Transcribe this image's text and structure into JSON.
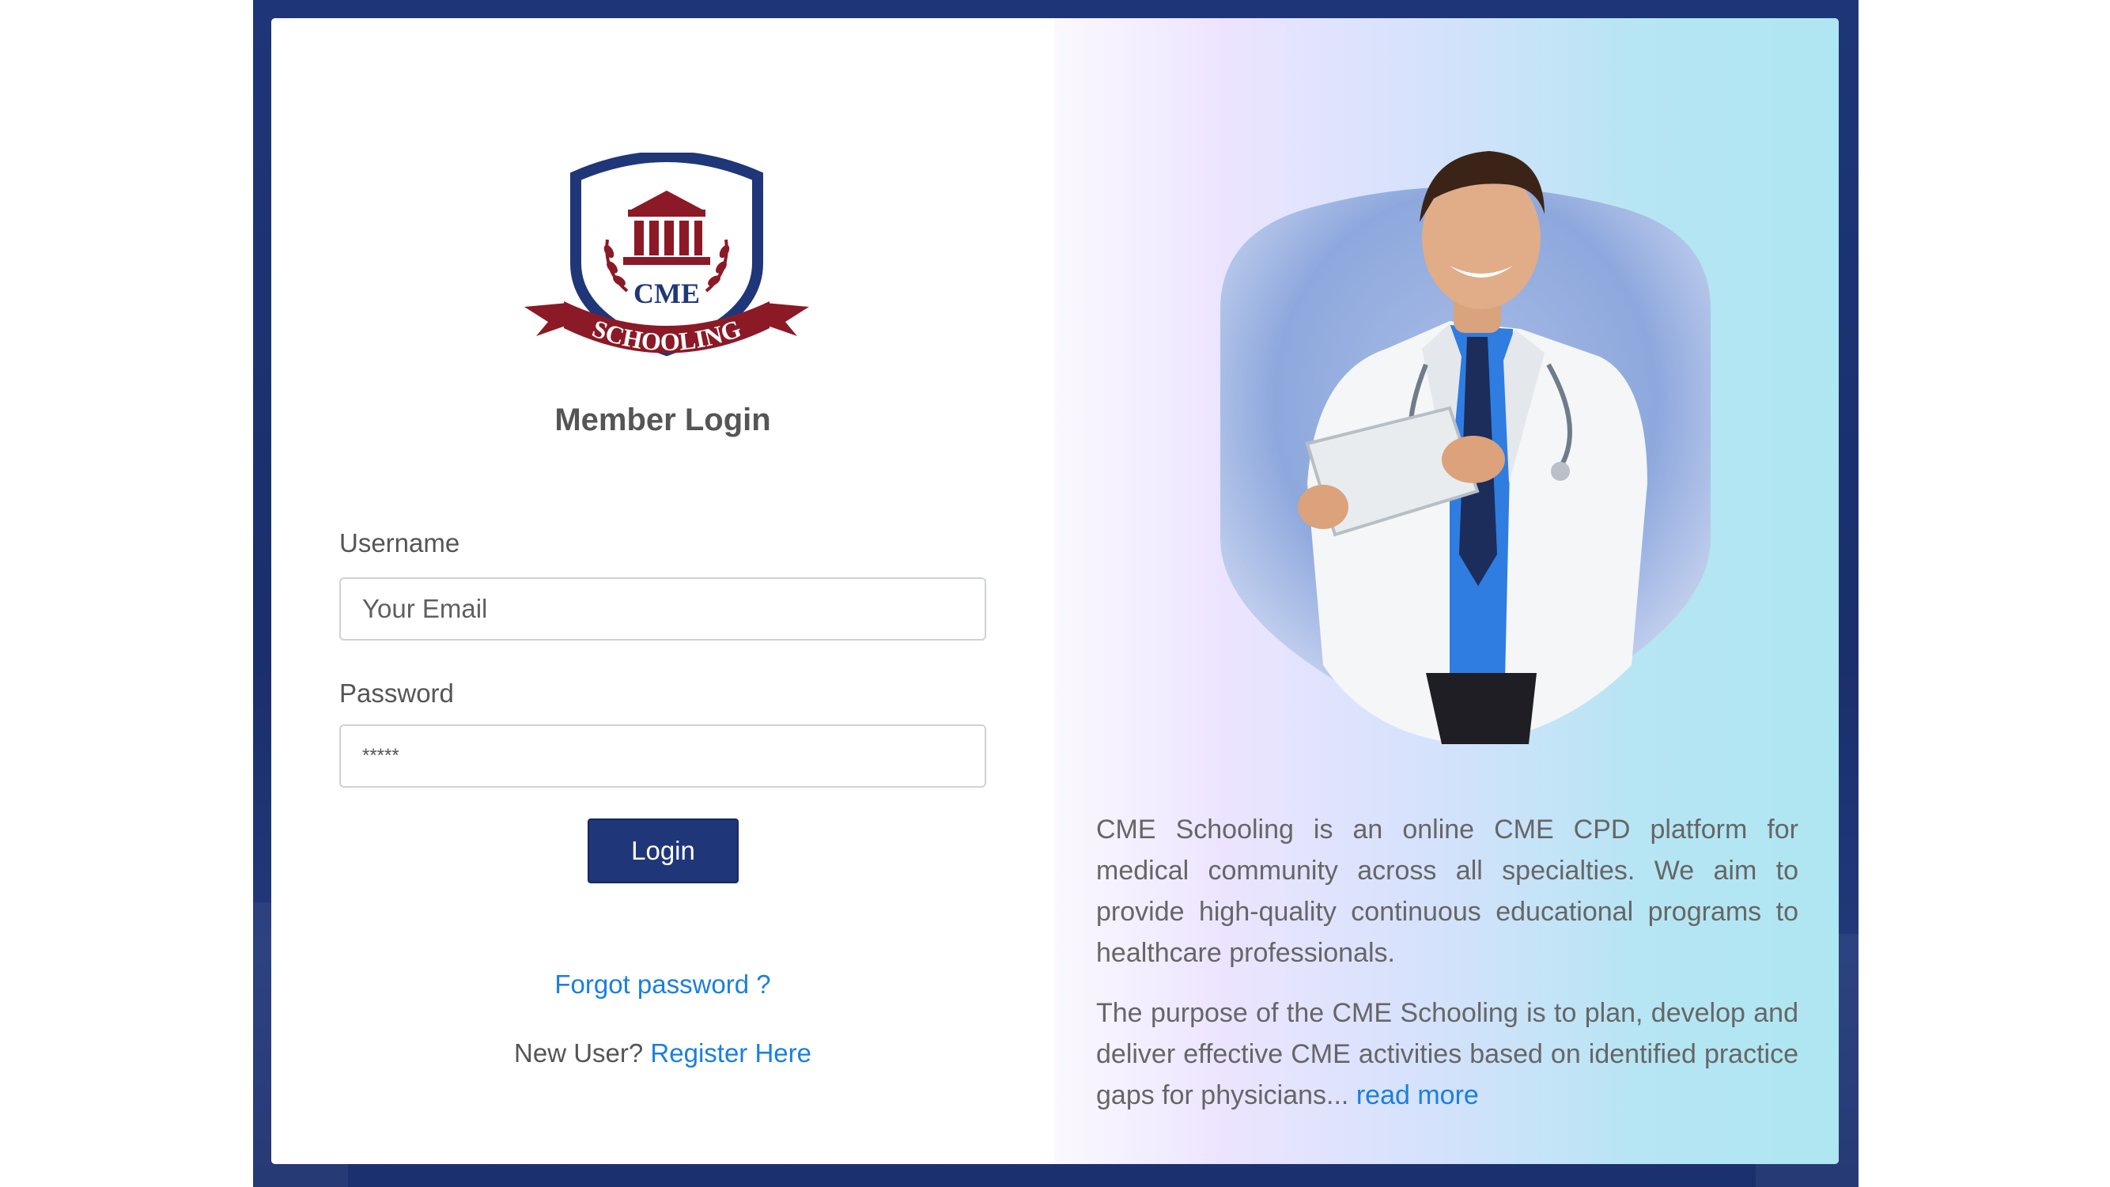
{
  "login": {
    "title": "Member Login",
    "username_label": "Username",
    "username_placeholder": "Your Email",
    "password_label": "Password",
    "password_value": "*****",
    "login_button": "Login",
    "forgot_password": "Forgot password ?",
    "new_user_text": "New User?",
    "register_link": "Register Here"
  },
  "logo": {
    "text_top": "CME",
    "text_bottom": "SCHOOLING"
  },
  "info": {
    "paragraph1": "CME Schooling is an online CME CPD platform for medical community across all specialties. We aim to provide high-quality continuous educational programs to healthcare professionals.",
    "paragraph2": "The purpose of the CME Schooling is to plan, develop and deliver effective CME activities based on identified practice gaps for physicians...",
    "read_more": "read more"
  },
  "colors": {
    "brand_navy": "#1f3778",
    "brand_maroon": "#8b1a26",
    "link_blue": "#1a7fe0"
  }
}
